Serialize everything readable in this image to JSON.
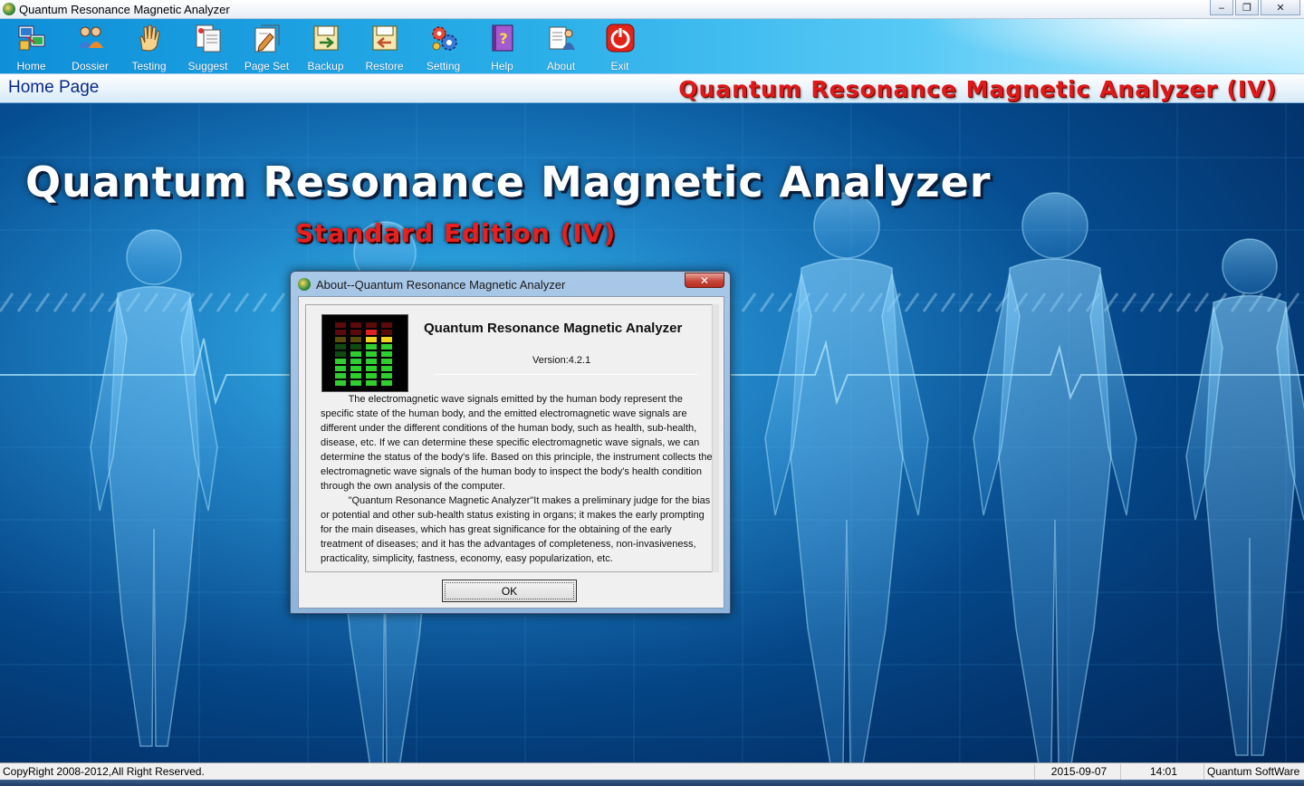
{
  "window": {
    "title": "Quantum Resonance Magnetic Analyzer",
    "controls": {
      "minimize": "‒",
      "maximize": "❐",
      "close": "✕"
    }
  },
  "toolbar": {
    "items": [
      {
        "label": "Home",
        "icon": "home-network-icon"
      },
      {
        "label": "Dossier",
        "icon": "users-icon"
      },
      {
        "label": "Testing",
        "icon": "hand-icon"
      },
      {
        "label": "Suggest",
        "icon": "documents-icon"
      },
      {
        "label": "Page Set",
        "icon": "page-settings-icon"
      },
      {
        "label": "Backup",
        "icon": "backup-icon"
      },
      {
        "label": "Restore",
        "icon": "restore-icon"
      },
      {
        "label": "Setting",
        "icon": "gears-icon"
      },
      {
        "label": "Help",
        "icon": "help-book-icon"
      },
      {
        "label": "About",
        "icon": "about-icon"
      },
      {
        "label": "Exit",
        "icon": "power-icon"
      }
    ]
  },
  "pagebar": {
    "title": "Home Page",
    "banner": "Quantum Resonance Magnetic Analyzer (IV)"
  },
  "hero": {
    "title": "Quantum Resonance Magnetic Analyzer",
    "subtitle": "Standard Edition (IV)"
  },
  "dialog": {
    "title": "About--Quantum Resonance Magnetic Analyzer",
    "close": "✕",
    "product": "Quantum Resonance Magnetic Analyzer",
    "version": "Version:4.2.1",
    "paragraph1": "The electromagnetic wave signals emitted by the human body represent the specific state of the human body, and the emitted electromagnetic wave signals are different under the different conditions of the human body, such as health, sub-health, disease, etc. If we can determine these specific electromagnetic wave signals, we can determine the status of the body's life. Based on this principle, the instrument collects the electromagnetic wave signals of the human body to inspect the body's health condition through the own analysis of the computer.",
    "paragraph2": "\"Quantum Resonance Magnetic Analyzer\"It makes a preliminary judge for the bias or potential and other sub-health status existing in organs; it makes the early prompting  for the main diseases, which has great significance for the obtaining  of the early treatment of diseases; and it has the advantages of completeness, non-invasiveness, practicality, simplicity, fastness, economy, easy popularization, etc.",
    "ok": "OK"
  },
  "statusbar": {
    "copyright": "CopyRight 2008-2012,All Right Reserved.",
    "date": "2015-09-07",
    "time": "14:01",
    "vendor": "Quantum SoftWare"
  },
  "colors": {
    "toolbar": "#29aee8",
    "banner_red": "#e01818",
    "page_title_blue": "#0a2a8a",
    "background_blue": "#064f93"
  }
}
